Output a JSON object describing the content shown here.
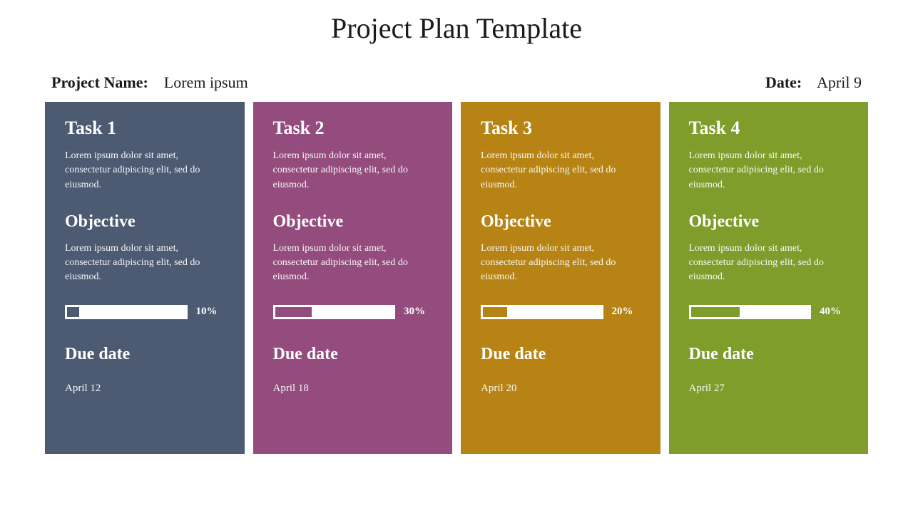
{
  "title": "Project Plan Template",
  "project_name_label": "Project Name:",
  "project_name_value": "Lorem ipsum",
  "date_label": "Date:",
  "date_value": "April 9",
  "lorem": "Lorem ipsum dolor sit amet, consectetur adipiscing elit, sed do eiusmod.",
  "objective_label": "Objective",
  "due_label": "Due date",
  "cards": [
    {
      "title": "Task 1",
      "bg": "#4c5a72",
      "fill": "#4c5a72",
      "progress": 10,
      "progress_label": "10%",
      "due": "April 12"
    },
    {
      "title": "Task 2",
      "bg": "#944b7e",
      "fill": "#944b7e",
      "progress": 30,
      "progress_label": "30%",
      "due": "April 18"
    },
    {
      "title": "Task 3",
      "bg": "#b68314",
      "fill": "#b68314",
      "progress": 20,
      "progress_label": "20%",
      "due": "April 20"
    },
    {
      "title": "Task 4",
      "bg": "#7e9d2b",
      "fill": "#7e9d2b",
      "progress": 40,
      "progress_label": "40%",
      "due": "April 27"
    }
  ]
}
